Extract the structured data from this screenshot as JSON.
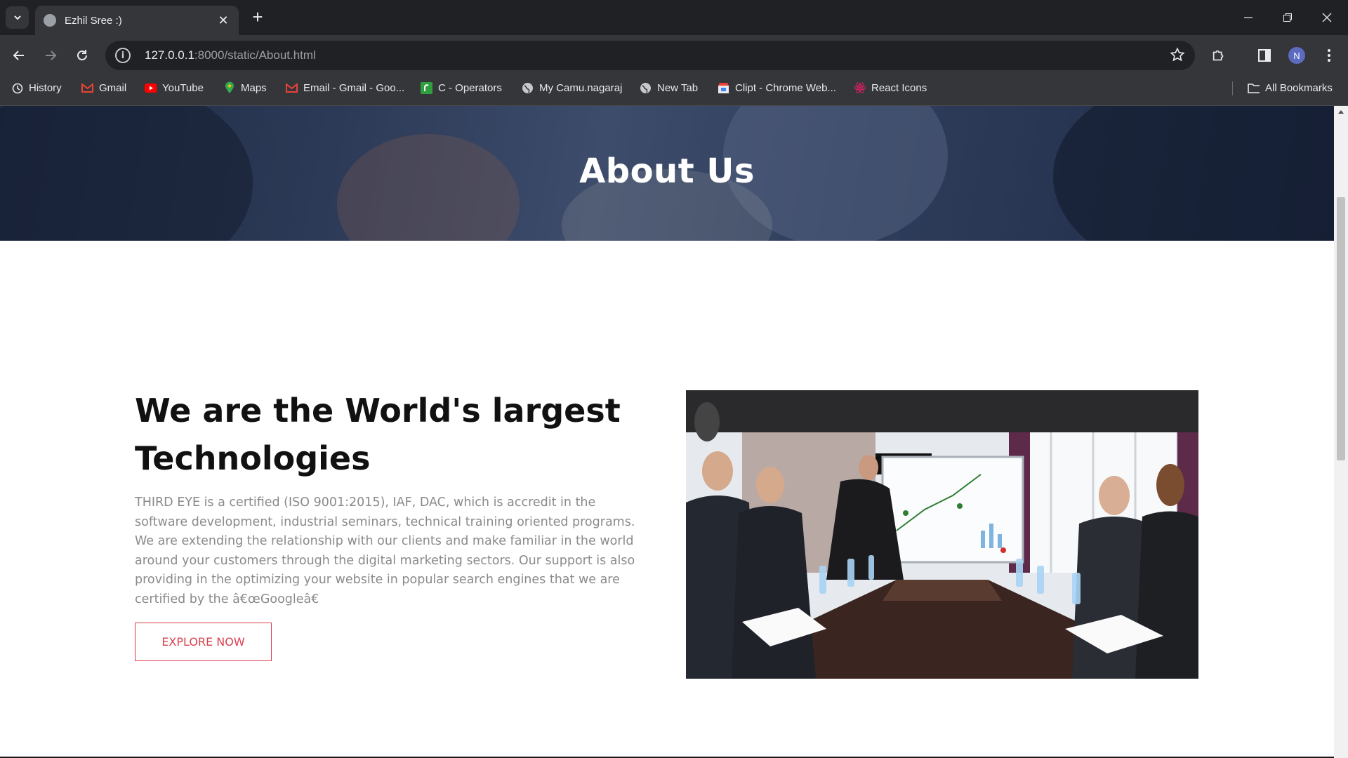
{
  "browser": {
    "tab_title": "Ezhil Sree :)",
    "url_host": "127.0.0.1",
    "url_rest": ":8000/static/About.html",
    "profile_initial": "N"
  },
  "bookmarks": [
    {
      "label": "History",
      "icon": "history-icon"
    },
    {
      "label": "Gmail",
      "icon": "gmail-icon"
    },
    {
      "label": "YouTube",
      "icon": "youtube-icon"
    },
    {
      "label": "Maps",
      "icon": "maps-icon"
    },
    {
      "label": "Email - Gmail - Goo...",
      "icon": "gmail-icon"
    },
    {
      "label": "C - Operators",
      "icon": "site-icon"
    },
    {
      "label": "My Camu.nagaraj",
      "icon": "globe-icon"
    },
    {
      "label": "New Tab",
      "icon": "globe-icon"
    },
    {
      "label": "Clipt - Chrome Web...",
      "icon": "store-icon"
    },
    {
      "label": "React Icons",
      "icon": "react-icon"
    }
  ],
  "all_bookmarks_label": "All Bookmarks",
  "page": {
    "hero_title": "About Us",
    "heading": "We are the World's largest Technologies",
    "paragraph": "THIRD EYE is a certified (ISO 9001:2015), IAF, DAC, which is accredit in the software development, industrial seminars, technical training oriented programs. We are extending the relationship with our clients and make familiar in the world around your customers through the digital marketing sectors. Our support is also providing in the optimizing your website in popular search engines that we are certified by the â€œGoogleâ€",
    "button_label": "EXPLORE NOW"
  },
  "colors": {
    "accent": "#d9414f",
    "hero_overlay": "#2c3a57"
  }
}
